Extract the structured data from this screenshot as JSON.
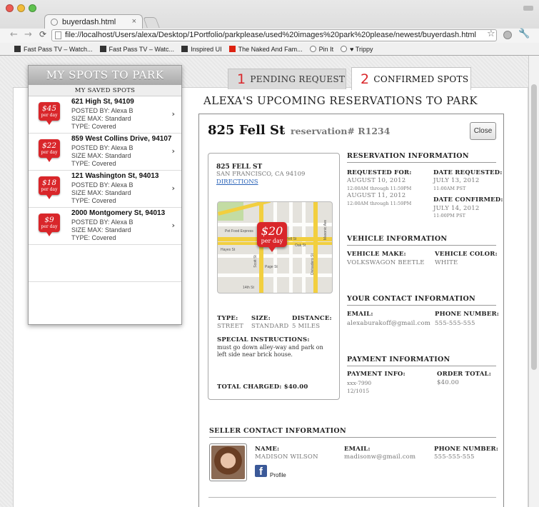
{
  "browser": {
    "tab_title": "buyerdash.html",
    "tab_close": "×",
    "url": "file://localhost/Users/alexa/Desktop/1Portfolio/parkplease/used%20images%20park%20please/newest/buyerdash.html",
    "bookmarks": [
      "Fast Pass TV – Watch...",
      "Fast Pass TV – Watc...",
      "Inspired UI",
      "The Naked And Fam...",
      "Pin It",
      "♥ Trippy"
    ]
  },
  "sidebar": {
    "title": "MY SPOTS TO PARK",
    "subtitle": "MY SAVED SPOTS",
    "spots": [
      {
        "price": "$45",
        "per": "per day",
        "address": "621 High St, 94109",
        "posted": "POSTED BY: Alexa B",
        "size": "SIZE MAX: Standard",
        "type": "TYPE: Covered"
      },
      {
        "price": "$22",
        "per": "per day",
        "address": "859 West Collins Drive, 94107",
        "posted": "POSTED BY: Alexa B",
        "size": "SIZE MAX: Standard",
        "type": "TYPE: Covered"
      },
      {
        "price": "$18",
        "per": "per day",
        "address": "121 Washington St, 94013",
        "posted": "POSTED BY: Alexa B",
        "size": "SIZE MAX: Standard",
        "type": "TYPE: Covered"
      },
      {
        "price": "$9",
        "per": "per day",
        "address": "2000 Montgomery St, 94013",
        "posted": "POSTED BY: Alexa B",
        "size": "SIZE MAX: Standard",
        "type": "TYPE: Covered"
      }
    ]
  },
  "tabs": {
    "pending_num": "1",
    "pending_label": "PENDING REQUEST",
    "confirmed_num": "2",
    "confirmed_label": "CONFIRMED SPOTS"
  },
  "heading": "ALEXA'S UPCOMING RESERVATIONS TO PARK",
  "reservation": {
    "street": "825 Fell St",
    "dash": "-",
    "number": "reservation# R1234",
    "close": "Close",
    "spot_name": "825 FELL ST",
    "city": "SAN FRANCISCO, CA 94109",
    "directions": "DIRECTIONS",
    "map_price": "$20",
    "map_per": "per day",
    "map_labels": [
      "Pet Food Express",
      "Hayes St",
      "Fell St",
      "Oak St",
      "Page St",
      "14th St",
      "Masonic Ave",
      "Scott St",
      "Divisadero St"
    ],
    "type_label": "TYPE:",
    "type_value": "STREET",
    "size_label": "SIZE:",
    "size_value": "STANDARD",
    "distance_label": "DISTANCE:",
    "distance_value": "5 MILES",
    "special_label": "SPECIAL INSTRUCTIONS:",
    "special_line1": "must go down alley-way and park on",
    "special_line2": "left side near brick house.",
    "total_charged": "TOTAL CHARGED: $40.00"
  },
  "reservation_info": {
    "header": "RESERVATION INFORMATION",
    "requested_for_label": "REQUESTED FOR:",
    "date1": "AUGUST 10, 2012",
    "time1": "12:00AM through 11:59PM",
    "date2": "AUGUST 11, 2012",
    "time2": "12:00AM through 11:59PM",
    "date_requested_label": "DATE REQUESTED:",
    "date_requested": "JULY 13, 2012",
    "date_requested_time": "11:00AM PST",
    "date_confirmed_label": "DATE CONFIRMED:",
    "date_confirmed": "JULY 14, 2012",
    "date_confirmed_time": "11:00PM PST"
  },
  "vehicle_info": {
    "header": "VEHICLE INFORMATION",
    "make_label": "VEHICLE MAKE:",
    "make": "VOLKSWAGON BEETLE",
    "color_label": "VEHICLE COLOR:",
    "color": "WHITE"
  },
  "contact_info": {
    "header": "YOUR CONTACT INFORMATION",
    "email_label": "EMAIL:",
    "email": "alexaburakoff@gmail.com",
    "phone_label": "PHONE NUMBER:",
    "phone": "555-555-555"
  },
  "payment_info": {
    "header": "PAYMENT INFORMATION",
    "info_label": "PAYMENT INFO:",
    "card": "xxx-7990",
    "expiry": "12/1015",
    "total_label": "ORDER TOTAL:",
    "total": "$40.00"
  },
  "seller": {
    "header": "SELLER CONTACT INFORMATION",
    "name_label": "NAME:",
    "name": "MADISON WILSON",
    "email_label": "EMAIL:",
    "email": "madisonw@gmail.com",
    "phone_label": "PHONE NUMBER:",
    "phone": "555-555-555",
    "profile": "Profile"
  },
  "colors": {
    "accent_red": "#d9262a",
    "link_blue": "#2a63b8",
    "facebook": "#3b5998"
  }
}
